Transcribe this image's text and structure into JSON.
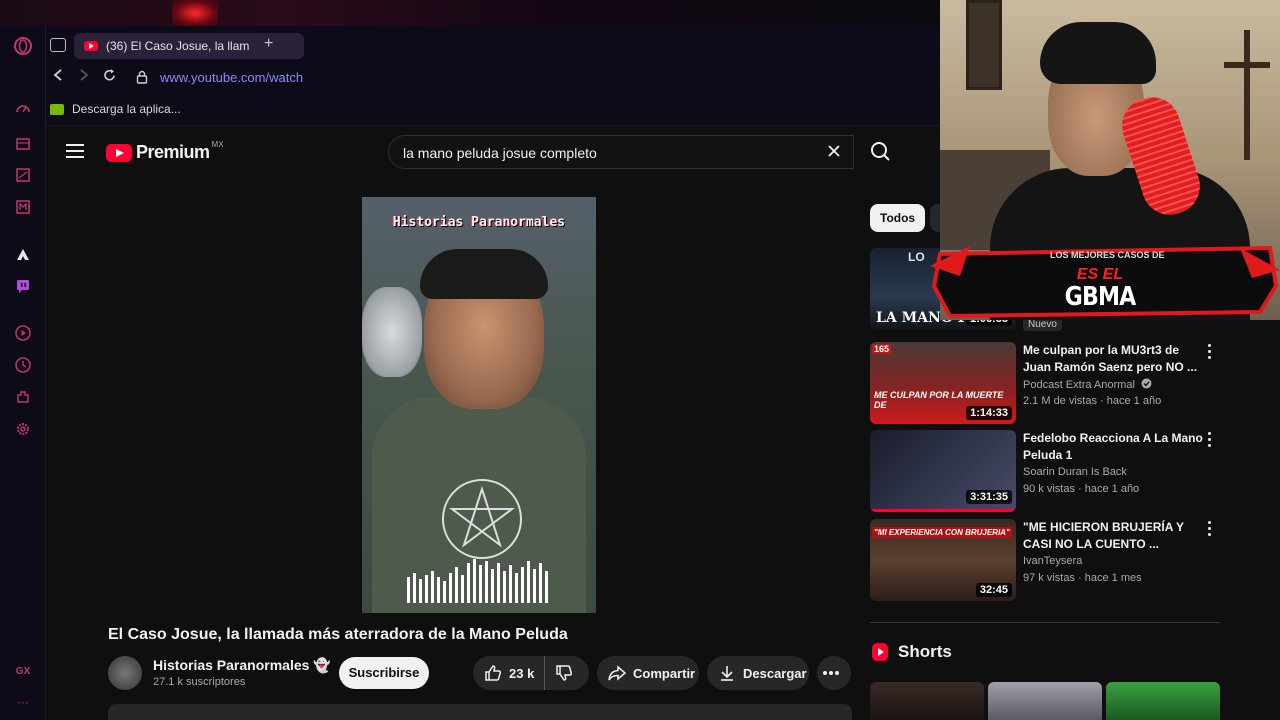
{
  "browser": {
    "tab_title": "(36) El Caso Josue, la llam",
    "new_tab": "+",
    "url": "www.youtube.com/watch",
    "bookmark": "Descarga la aplica..."
  },
  "sidebar": {
    "gx_label": "GX",
    "more_label": "···"
  },
  "youtube": {
    "brand": "Premium",
    "region": "MX",
    "search_query": "la mano peluda josue completo",
    "video_overlay_title": "Historias Paranormales",
    "video_title": "El Caso Josue, la llamada más aterradora de la Mano Peluda",
    "channel_name": "Historias Paranormales",
    "channel_emoji": "👻",
    "subscribers": "27.1 k suscriptores",
    "subscribe_label": "Suscribirse",
    "likes": "23 k",
    "share_label": "Compartir",
    "download_label": "Descargar"
  },
  "filters": {
    "active": "Todos"
  },
  "recommendations": [
    {
      "title": "",
      "thumb_text": "LA MANO PE",
      "thumb_top": "LO",
      "duration": "1:06:35",
      "badge": "Nuevo",
      "channel": "",
      "meta": ""
    },
    {
      "title": "Me culpan por la MU3rt3 de Juan Ramón Saenz pero NO ...",
      "thumb_text": "ME CULPAN POR LA MUERTE DE",
      "thumb_badge": "165",
      "duration": "1:14:33",
      "channel": "Podcast Extra Anormal",
      "meta": "2.1 M de vistas · hace 1 año"
    },
    {
      "title": "Fedelobo Reacciona A La Mano Peluda 1",
      "duration": "3:31:35",
      "channel": "Soarin Duran Is Back",
      "meta": "90 k vistas · hace 1 año",
      "watched_fraction": 1.0
    },
    {
      "title": "\"ME HICIERON BRUJERÍA Y CASI NO LA CUENTO ...",
      "thumb_text": "\"MI EXPERIENCIA CON BRUJERIA\"",
      "duration": "32:45",
      "channel": "IvanTeysera",
      "meta": "97 k vistas · hace 1 mes"
    }
  ],
  "shorts": {
    "heading": "Shorts"
  },
  "overlay": {
    "banner_top": "LOS MEJORES CASOS DE",
    "banner_mid": "ES EL",
    "banner_main": "GBMA"
  },
  "colors": {
    "yt_red": "#ff0033",
    "opera_accent": "#c2376a",
    "bg": "#0f0f0f"
  }
}
